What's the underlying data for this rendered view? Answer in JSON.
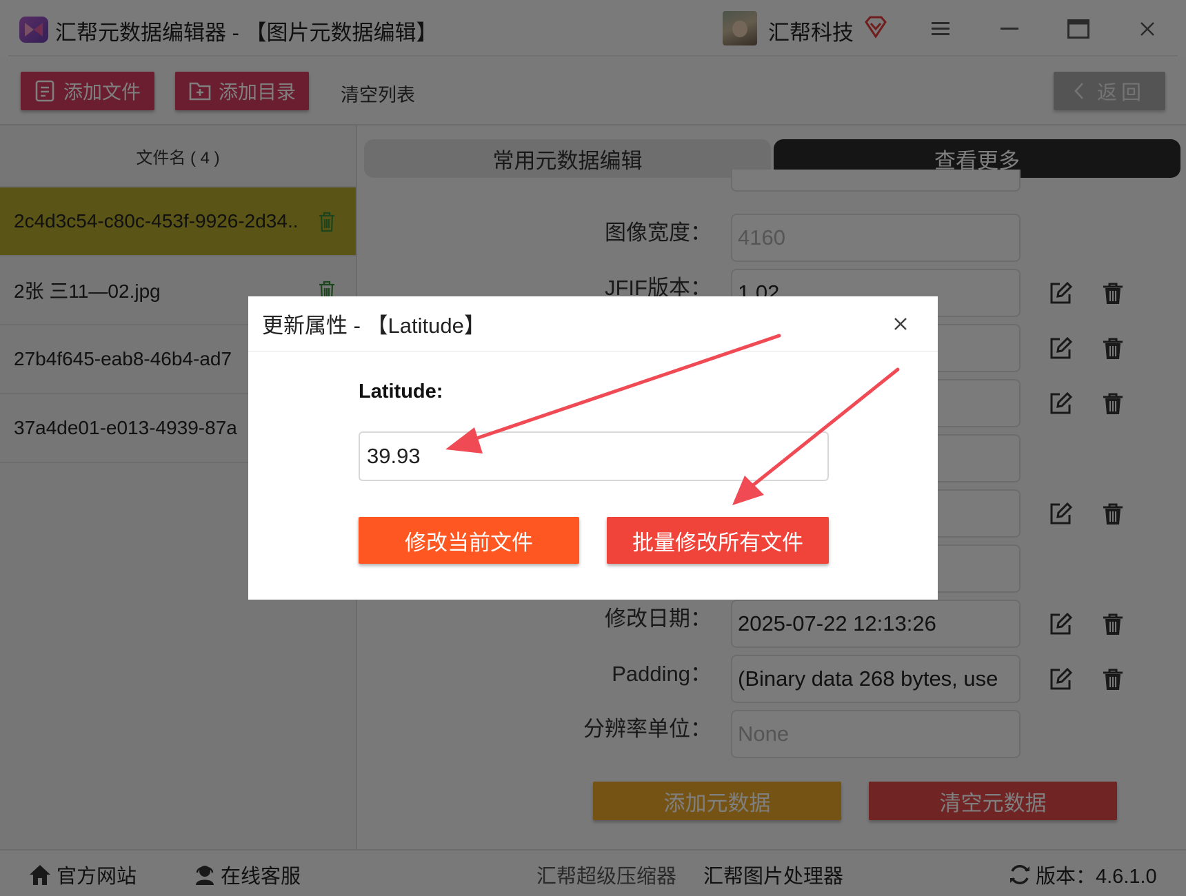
{
  "window": {
    "title": "汇帮元数据编辑器 - 【图片元数据编辑】",
    "company": "汇帮科技"
  },
  "toolbar": {
    "add_file": "添加文件",
    "add_folder": "添加目录",
    "clear_list": "清空列表",
    "back": "返回"
  },
  "file_list": {
    "header": "文件名 ( 4 )",
    "files": [
      "2c4d3c54-c80c-453f-9926-2d34..",
      "2张 三11—02.jpg",
      "27b4f645-eab8-46b4-ad7",
      "37a4de01-e013-4939-87a"
    ]
  },
  "tabs": {
    "common": "常用元数据编辑",
    "more": "查看更多"
  },
  "fields": [
    {
      "label": "图像宽度：",
      "value": "4160"
    },
    {
      "label": "JFIF版本：",
      "value": "1.02"
    },
    {
      "label": "修改日期：",
      "value": "2025-07-22 12:13:26"
    },
    {
      "label": "Padding：",
      "value": "(Binary data 268 bytes, use"
    },
    {
      "label": "分辨率单位：",
      "value": "None"
    }
  ],
  "meta_buttons": {
    "add": "添加元数据",
    "clear": "清空元数据"
  },
  "statusbar": {
    "website": "官方网站",
    "support": "在线客服",
    "compressor": "汇帮超级压缩器",
    "image_processor": "汇帮图片处理器",
    "version": "版本：4.6.1.0"
  },
  "dialog": {
    "title": "更新属性 - 【Latitude】",
    "field_label": "Latitude:",
    "value": "39.93",
    "modify_current": "修改当前文件",
    "modify_all": "批量修改所有文件"
  },
  "colors": {
    "toolbar_button": "#d53c5e",
    "selected_row": "#b5a82c",
    "dialog_current_button": "#ff5722",
    "dialog_all_button": "#f0433a",
    "arrow": "#f04a55"
  }
}
